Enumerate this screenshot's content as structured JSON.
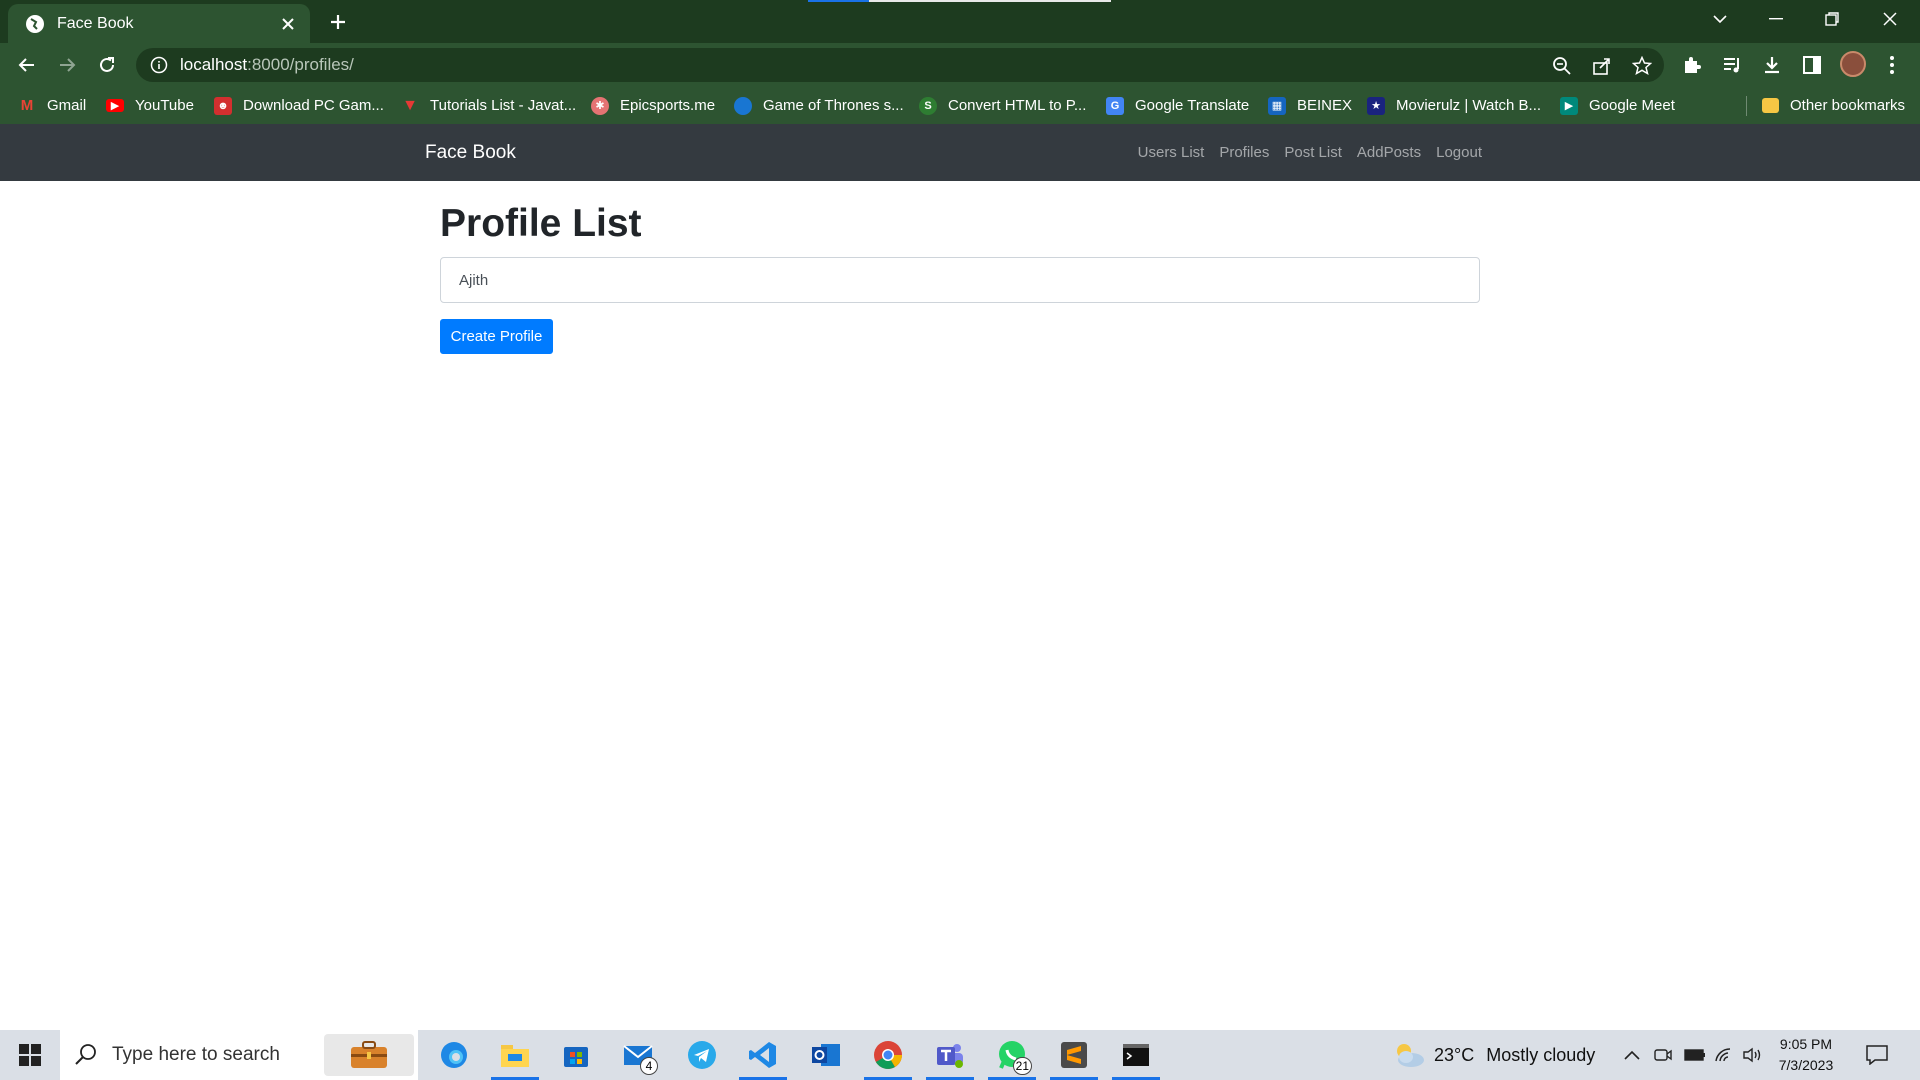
{
  "browser": {
    "tab_title": "Face Book",
    "url_host": "localhost",
    "url_path": ":8000/profiles/"
  },
  "bookmarks": [
    {
      "label": "Gmail",
      "icon": "gmail-icon",
      "color": "#ea4335"
    },
    {
      "label": "YouTube",
      "icon": "youtube-icon",
      "color": "#ff0000"
    },
    {
      "label": "Download PC Gam...",
      "icon": "game-icon",
      "color": "#d32f2f"
    },
    {
      "label": "Tutorials List - Javat...",
      "icon": "javatpoint-icon",
      "color": "#e53935"
    },
    {
      "label": "Epicsports.me",
      "icon": "epicsports-icon",
      "color": "#e57373"
    },
    {
      "label": "Game of Thrones s...",
      "icon": "globe-icon",
      "color": "#1976d2"
    },
    {
      "label": "Convert HTML to P...",
      "icon": "convert-icon",
      "color": "#2e7d32"
    },
    {
      "label": "Google Translate",
      "icon": "google-translate-icon",
      "color": "#4285f4"
    },
    {
      "label": "BEINEX",
      "icon": "beinex-icon",
      "color": "#1565c0"
    },
    {
      "label": "Movierulz | Watch B...",
      "icon": "movierulz-icon",
      "color": "#1a237e"
    },
    {
      "label": "Google Meet",
      "icon": "google-meet-icon",
      "color": "#00897b"
    },
    {
      "label": "Other bookmarks",
      "icon": "folder-icon",
      "color": "#f6c744"
    }
  ],
  "app": {
    "brand": "Face Book",
    "nav": [
      "Users List",
      "Profiles",
      "Post List",
      "AddPosts",
      "Logout"
    ],
    "page_title": "Profile List",
    "search_value": "Ajith",
    "create_button": "Create Profile"
  },
  "taskbar": {
    "search_placeholder": "Type here to search",
    "mail_badge": "4",
    "whatsapp_badge": "21",
    "weather_temp": "23°C",
    "weather_desc": "Mostly cloudy",
    "time": "9:05 PM",
    "date": "7/3/2023"
  }
}
